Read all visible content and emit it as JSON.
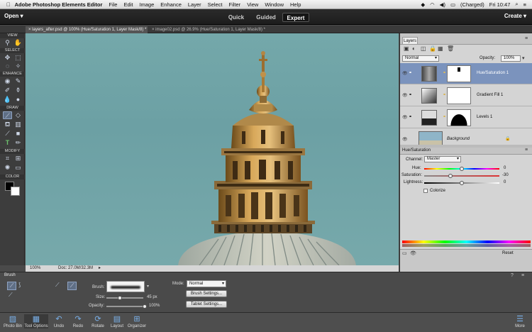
{
  "menubar": {
    "apple": "",
    "app": "Adobe Photoshop Elements Editor",
    "items": [
      "File",
      "Edit",
      "Image",
      "Enhance",
      "Layer",
      "Select",
      "Filter",
      "View",
      "Window",
      "Help"
    ],
    "battery": "(Charged)",
    "clock": "Fri 10:47"
  },
  "modebar": {
    "open": "Open ▾",
    "modes": [
      "Quick",
      "Guided",
      "Expert"
    ],
    "active_mode": "Expert",
    "create": "Create ▾"
  },
  "tabs": [
    {
      "label": "layers_after.psd @ 100% (Hue/Saturation 1, Layer Mask/8) *"
    },
    {
      "label": "image02.psd @ 26.9% (Hue/Saturation 1, Layer Mask/8) *"
    }
  ],
  "toolbox": {
    "sections": {
      "view": "VIEW",
      "select": "SELECT",
      "enhance": "ENHANCE",
      "draw": "DRAW",
      "modify": "MODIFY",
      "color": "COLOR"
    }
  },
  "status": {
    "zoom": "100%",
    "doc": "Doc: 27.0M/32.3M"
  },
  "layers_panel": {
    "tab": "Layers",
    "blend_mode": "Normal",
    "opacity_label": "Opacity:",
    "opacity_value": "100%",
    "layers": [
      {
        "name": "Hue/Saturation 1"
      },
      {
        "name": "Gradient Fill 1"
      },
      {
        "name": "Levels 1"
      },
      {
        "name": "Background"
      }
    ]
  },
  "hue_panel": {
    "title": "Hue/Saturation",
    "channel_label": "Channel:",
    "channel_value": "Master",
    "hue_label": "Hue:",
    "hue_value": "0",
    "sat_label": "Saturation:",
    "sat_value": "-30",
    "light_label": "Lightness:",
    "light_value": "0",
    "colorize": "Colorize",
    "reset": "Reset",
    "levels": {
      "hue": 0,
      "saturation": -30,
      "lightness": 0
    }
  },
  "options": {
    "tool": "Brush",
    "brush_label": "Brush:",
    "size_label": "Size:",
    "size_value": "45 px",
    "opacity_label": "Opacity:",
    "opacity_value": "100%",
    "mode_label": "Mode:",
    "mode_value": "Normal",
    "brush_settings": "Brush Settings...",
    "tablet_settings": "Tablet Settings..."
  },
  "bottombar": {
    "items": [
      "Photo Bin",
      "Tool Options",
      "Undo",
      "Redo",
      "Rotate",
      "Layout",
      "Organizer"
    ],
    "more": "More"
  },
  "colors": {
    "accent": "#7b93bd",
    "sky": "#70a4a8"
  }
}
